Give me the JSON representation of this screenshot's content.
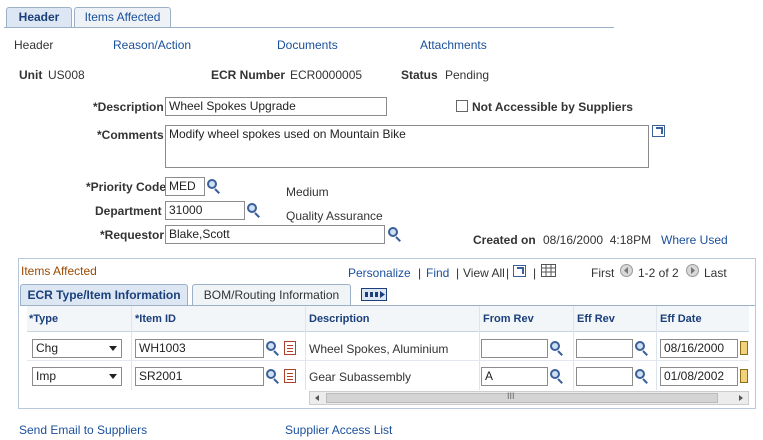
{
  "page_tabs": [
    {
      "label": "Header",
      "active": true
    },
    {
      "label": "Items Affected",
      "active": false
    }
  ],
  "subnav": {
    "header": "Header",
    "reason_action": "Reason/Action",
    "documents": "Documents",
    "attachments": "Attachments"
  },
  "info": {
    "unit_label": "Unit",
    "unit_value": "US008",
    "ecr_label": "ECR Number",
    "ecr_value": "ECR0000005",
    "status_label": "Status",
    "status_value": "Pending"
  },
  "form": {
    "description_label": "*Description",
    "description_value": "Wheel Spokes Upgrade",
    "not_accessible_label": "Not Accessible by Suppliers",
    "comments_label": "*Comments",
    "comments_value": "Modify wheel spokes used on Mountain Bike",
    "priority_label": "*Priority Code",
    "priority_value": "MED",
    "priority_desc": "Medium",
    "department_label": "Department",
    "department_value": "31000",
    "department_desc": "Quality Assurance",
    "requestor_label": "*Requestor",
    "requestor_value": "Blake,Scott",
    "created_on_label": "Created on",
    "created_on_value": "08/16/2000  4:18PM",
    "where_used": "Where Used"
  },
  "grid": {
    "title": "Items Affected",
    "personalize": "Personalize",
    "find": "Find",
    "view_all": "View All",
    "first": "First",
    "range": "1-2 of 2",
    "last": "Last",
    "tabs": [
      "ECR Type/Item Information",
      "BOM/Routing Information"
    ],
    "columns": [
      "*Type",
      "*Item ID",
      "Description",
      "From Rev",
      "Eff Rev",
      "Eff Date"
    ],
    "rows": [
      {
        "type": "Chg",
        "item_id": "WH1003",
        "description": "Wheel Spokes, Aluminium",
        "from_rev": "",
        "eff_rev": "",
        "eff_date": "08/16/2000"
      },
      {
        "type": "Imp",
        "item_id": "SR2001",
        "description": "Gear Subassembly",
        "from_rev": "A",
        "eff_rev": "",
        "eff_date": "01/08/2002"
      }
    ],
    "scroll_grip": "III"
  },
  "footer": {
    "send_email": "Send Email to Suppliers",
    "supplier_access": "Supplier Access List"
  }
}
